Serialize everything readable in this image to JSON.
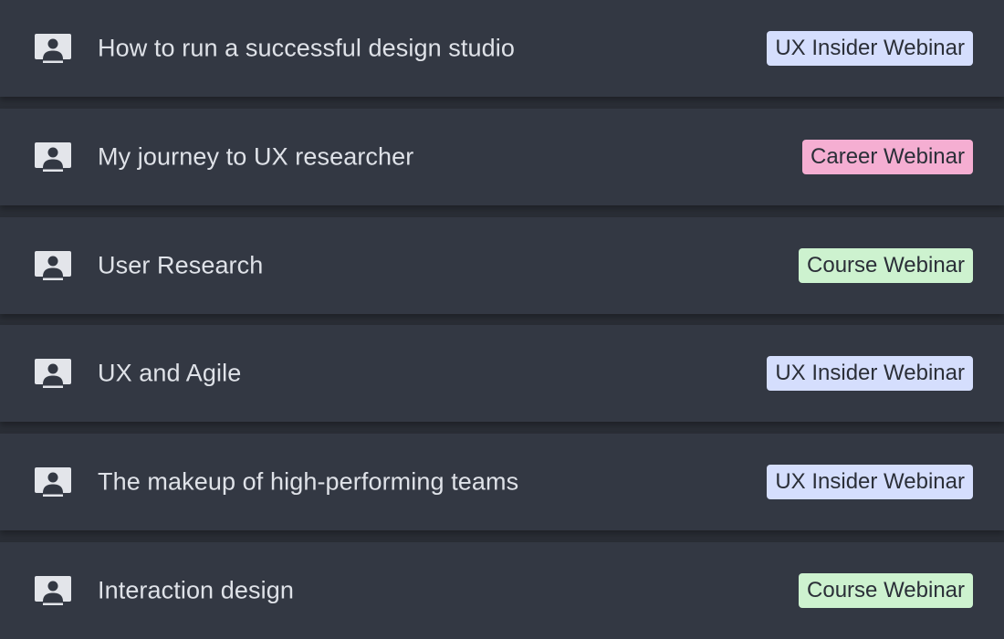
{
  "colors": {
    "background": "#2a2e36",
    "row": "#333843",
    "text": "#dfe2e8",
    "badge_ux_insider": "#d5defd",
    "badge_career": "#f5aed2",
    "badge_course": "#cdf2cf"
  },
  "items": [
    {
      "icon": "person-presentation-icon",
      "title": "How to run a successful design studio",
      "badge": "UX Insider Webinar",
      "badge_type": "ux"
    },
    {
      "icon": "person-presentation-icon",
      "title": "My journey to UX researcher",
      "badge": "Career Webinar",
      "badge_type": "career"
    },
    {
      "icon": "person-presentation-icon",
      "title": "User Research",
      "badge": "Course Webinar",
      "badge_type": "course"
    },
    {
      "icon": "person-presentation-icon",
      "title": "UX and Agile",
      "badge": "UX Insider Webinar",
      "badge_type": "ux"
    },
    {
      "icon": "person-presentation-icon",
      "title": "The makeup of high-performing teams",
      "badge": "UX Insider Webinar",
      "badge_type": "ux"
    },
    {
      "icon": "person-presentation-icon",
      "title": "Interaction design",
      "badge": "Course Webinar",
      "badge_type": "course"
    }
  ]
}
